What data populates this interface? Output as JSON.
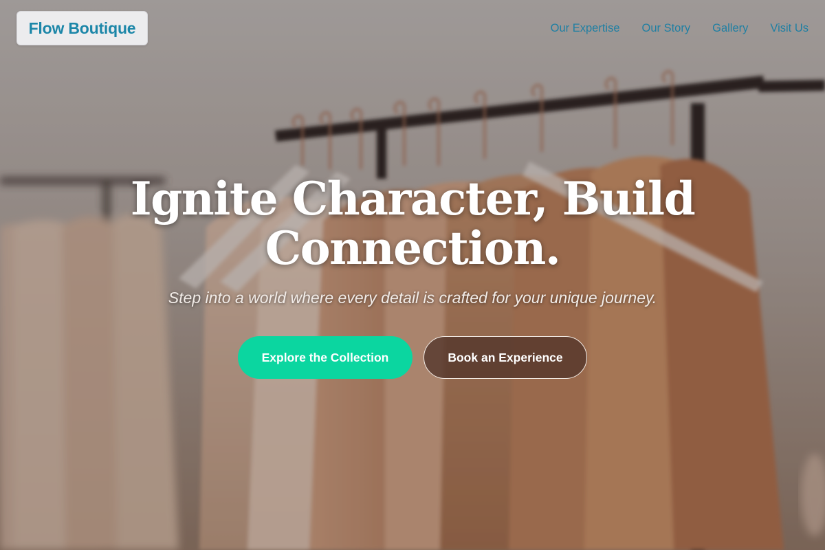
{
  "header": {
    "brand": "Flow Boutique",
    "nav": [
      {
        "label": "Our Expertise"
      },
      {
        "label": "Our Story"
      },
      {
        "label": "Gallery"
      },
      {
        "label": "Visit Us"
      }
    ]
  },
  "hero": {
    "title": "Ignite Character, Build Connection.",
    "subtitle": "Step into a world where every detail is crafted for your unique journey.",
    "primary_cta": "Explore the Collection",
    "secondary_cta": "Book an Experience"
  },
  "background": {
    "description_icon": "clothing-rack-photo"
  },
  "colors": {
    "brand": "#1b86a8",
    "nav_link": "#1f7fa3",
    "primary_button": "#0bd6a0",
    "secondary_button": "#52342a"
  }
}
